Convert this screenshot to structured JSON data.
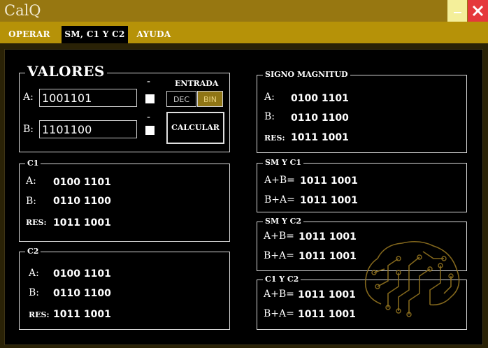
{
  "app": {
    "title": "CalQ"
  },
  "window": {
    "minimize_icon": "minimize-icon",
    "close_icon": "close-icon"
  },
  "tabs": [
    {
      "label": "OPERAR",
      "active": false
    },
    {
      "label": "SM, C1 Y C2",
      "active": true
    },
    {
      "label": "AYUDA",
      "active": false
    }
  ],
  "valores": {
    "title": "VALORES",
    "a_label": "A:",
    "a_value": "1001101",
    "b_label": "B:",
    "b_value": "1101100",
    "sign_a": "-",
    "sign_b": "-",
    "entrada_label": "ENTRADA",
    "dec_label": "DEC",
    "bin_label": "BIN",
    "selected_mode": "BIN",
    "calc_label": "CALCULAR"
  },
  "c1": {
    "title": "C1",
    "a_label": "A:",
    "a_value": "0100 1101",
    "b_label": "B:",
    "b_value": "0110 1100",
    "res_label": "RES:",
    "res_value": "1011 1001"
  },
  "c2": {
    "title": "C2",
    "a_label": "A:",
    "a_value": "0100 1101",
    "b_label": "B:",
    "b_value": "0110 1100",
    "res_label": "RES:",
    "res_value": "1011 1001"
  },
  "sm": {
    "title": "SIGNO MAGNITUD",
    "a_label": "A:",
    "a_value": "0100 1101",
    "b_label": "B:",
    "b_value": "0110 1100",
    "res_label": "RES:",
    "res_value": "1011 1001"
  },
  "sm_c1": {
    "title": "SM Y C1",
    "ab_label": "A+B=",
    "ab_value": "1011 1001",
    "ba_label": "B+A=",
    "ba_value": "1011 1001"
  },
  "sm_c2": {
    "title": "SM Y C2",
    "ab_label": "A+B=",
    "ab_value": "1011 1001",
    "ba_label": "B+A=",
    "ba_value": "1011 1001"
  },
  "c1_c2": {
    "title": "C1 Y C2",
    "ab_label": "A+B=",
    "ab_value": "1011 1001",
    "ba_label": "B+A=",
    "ba_value": "1011 1001"
  },
  "colors": {
    "gold": "#b69208",
    "titlebar": "#977711",
    "close": "#e5383b",
    "background": "#000000"
  },
  "decor": {
    "icon": "brain-circuit-icon"
  }
}
